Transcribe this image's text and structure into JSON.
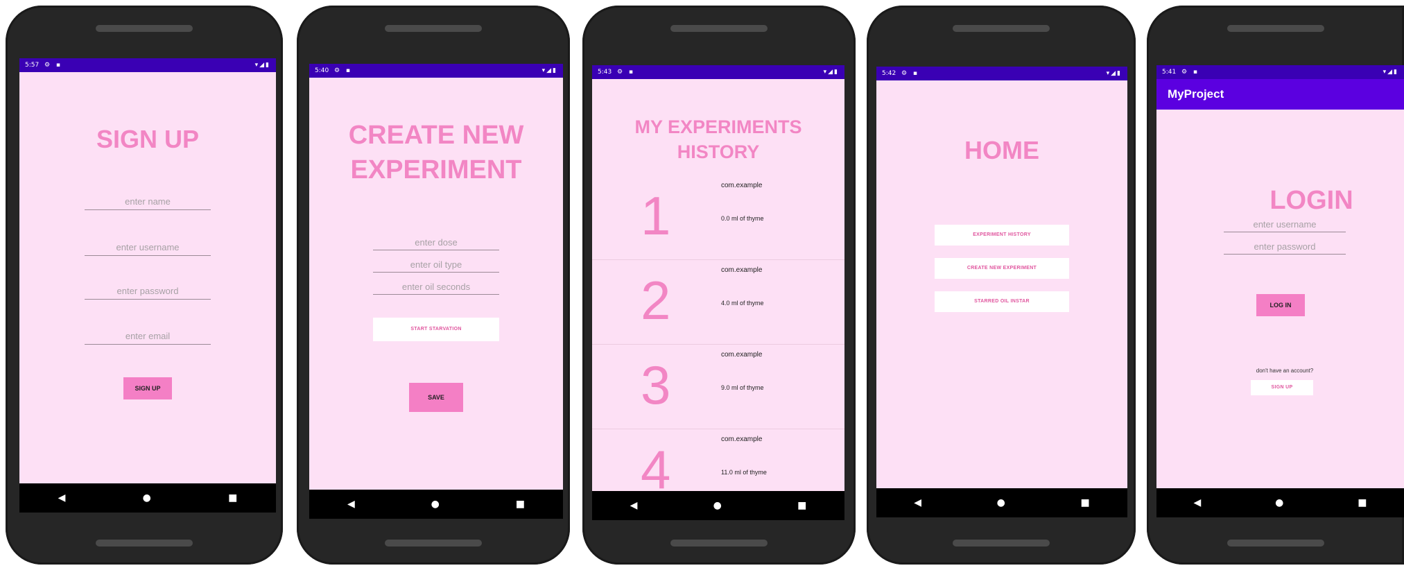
{
  "colors": {
    "screen_bg": "#fde0f5",
    "status_bar": "#3a00b4",
    "app_bar": "#5b00e0",
    "accent_pink": "#f286c4",
    "button_pink": "#f47fc5"
  },
  "status": {
    "time1": "5:57",
    "time2": "5:40",
    "time3": "5:43",
    "time4": "5:42",
    "time5": "5:41",
    "left_icons": "⚙ ▪",
    "right_icons": "▾◢▮"
  },
  "nav": {
    "back": "◀",
    "home": "●",
    "recents": "■"
  },
  "signup": {
    "title": "SIGN UP",
    "name_placeholder": "enter name",
    "username_placeholder": "enter username",
    "password_placeholder": "enter password",
    "email_placeholder": "enter email",
    "signup_button": "SIGN UP"
  },
  "create": {
    "title_line1": "CREATE NEW",
    "title_line2": "EXPERIMENT",
    "dose_placeholder": "enter dose",
    "oil_placeholder": "enter oil type",
    "seconds_placeholder": "enter oil seconds",
    "start_button": "START STARVATION",
    "save_button": "SAVE"
  },
  "history": {
    "title_line1": "MY EXPERIMENTS",
    "title_line2": "HISTORY",
    "items": [
      {
        "num": "1",
        "name": "com.example",
        "dose": "0.0 ml of thyme"
      },
      {
        "num": "2",
        "name": "com.example",
        "dose": "4.0 ml of thyme"
      },
      {
        "num": "3",
        "name": "com.example",
        "dose": "9.0 ml of thyme"
      },
      {
        "num": "4",
        "name": "com.example",
        "dose": "11.0 ml of thyme"
      }
    ]
  },
  "home": {
    "title": "HOME",
    "history_button": "EXPERIMENT HISTORY",
    "create_button": "CREATE NEW EXPERIMENT",
    "stored_button": "STARRED OIL INSTAR"
  },
  "login": {
    "app_title": "MyProject",
    "title": "LOGIN",
    "username_placeholder": "enter username",
    "password_placeholder": "enter password",
    "login_button": "LOG IN",
    "no_account": "don't have an account?",
    "signup_button": "SIGN UP"
  }
}
